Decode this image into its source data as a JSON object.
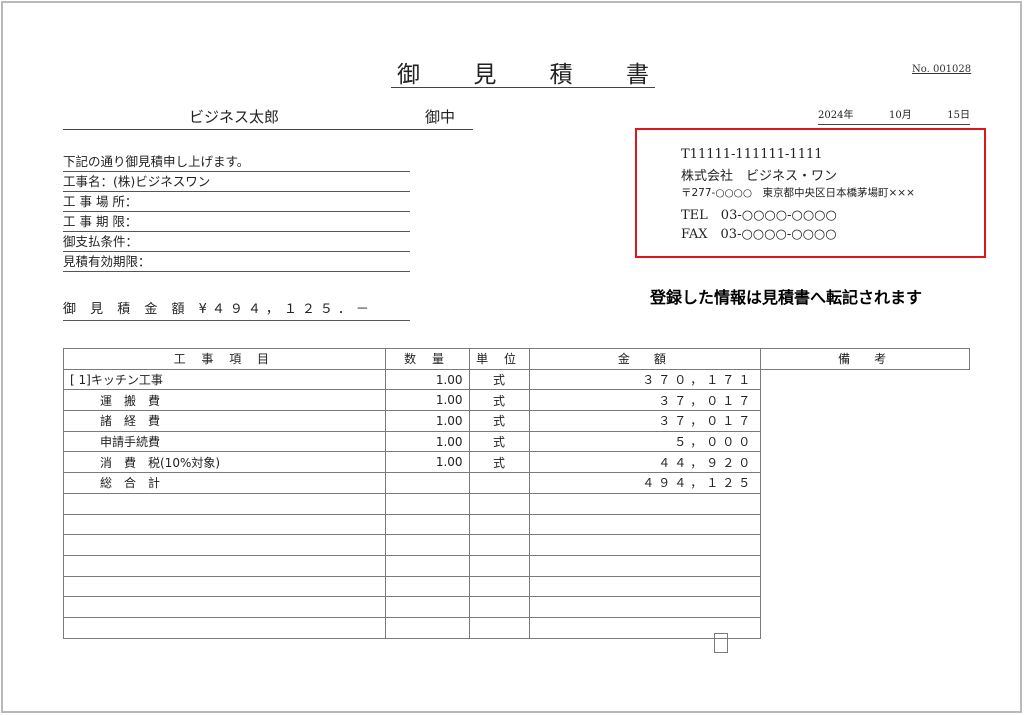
{
  "document": {
    "title_chars": [
      "御",
      "見",
      "積",
      "書"
    ],
    "number": "No. 001028",
    "date": {
      "year": "2024年",
      "month": "10月",
      "day": "15日"
    },
    "recipient": {
      "name": "ビジネス太郎",
      "honorific": "御中"
    },
    "intro_lines": [
      "下記の通り御見積申し上げます。",
      "工事名：(株)ビジネスワン",
      "工 事 場 所：",
      "工 事 期 限：",
      "御支払条件：",
      "見積有効期限："
    ],
    "total_line": "御 見 積 金 額 ¥４９４，１２５．－"
  },
  "issuer": {
    "registration": "T11111-111111-1111",
    "company": "株式会社　ビジネス・ワン",
    "address": "〒277-○○○○　東京都中央区日本橋茅場町×××",
    "tel": "TEL　03-○○○○-○○○○",
    "fax": "FAX　03-○○○○-○○○○",
    "highlight_color": "#e3131b"
  },
  "annotation": "登録した情報は見積書へ転記されます",
  "table": {
    "headers": [
      "工 事 項 目",
      "数 量",
      "単 位",
      "金　額",
      "備　考"
    ],
    "rows": [
      {
        "item": "[ 1]キッチン工事",
        "qty": "1.00",
        "unit": "式",
        "amount": "３７０，１７１",
        "note": ""
      },
      {
        "item": "運　搬　費",
        "qty": "1.00",
        "unit": "式",
        "amount": "３７，０１７",
        "note": ""
      },
      {
        "item": "諸　経　費",
        "qty": "1.00",
        "unit": "式",
        "amount": "３７，０１７",
        "note": ""
      },
      {
        "item": "申請手続費",
        "qty": "1.00",
        "unit": "式",
        "amount": "５，０００",
        "note": ""
      },
      {
        "item": "消　費　税(10%対象)",
        "qty": "1.00",
        "unit": "式",
        "amount": "４４，９２０",
        "note": ""
      },
      {
        "item": "総　合　計",
        "qty": "",
        "unit": "",
        "amount": "４９４，１２５",
        "note": ""
      },
      {
        "item": "",
        "qty": "",
        "unit": "",
        "amount": "",
        "note": ""
      },
      {
        "item": "",
        "qty": "",
        "unit": "",
        "amount": "",
        "note": ""
      },
      {
        "item": "",
        "qty": "",
        "unit": "",
        "amount": "",
        "note": ""
      },
      {
        "item": "",
        "qty": "",
        "unit": "",
        "amount": "",
        "note": ""
      },
      {
        "item": "",
        "qty": "",
        "unit": "",
        "amount": "",
        "note": ""
      },
      {
        "item": "",
        "qty": "",
        "unit": "",
        "amount": "",
        "note": ""
      },
      {
        "item": "",
        "qty": "",
        "unit": "",
        "amount": "",
        "note": ""
      }
    ]
  }
}
